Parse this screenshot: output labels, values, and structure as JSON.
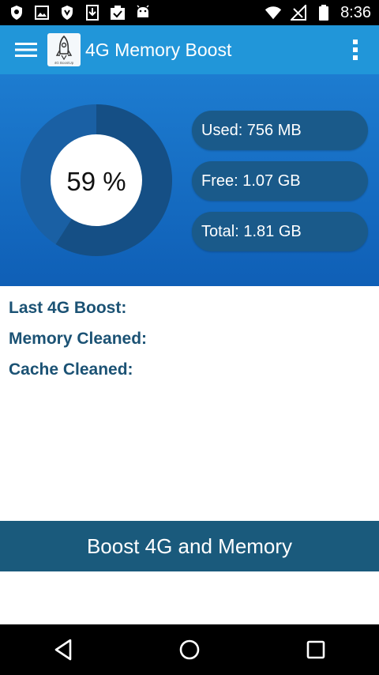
{
  "status_bar": {
    "time": "8:36",
    "left_icons": [
      "shield-icon",
      "image-icon",
      "shield-icon",
      "download-icon",
      "clipboard-check-icon",
      "android-icon"
    ],
    "right_icons": [
      "wifi-icon",
      "signal-icon",
      "battery-icon"
    ]
  },
  "app_bar": {
    "title": "4G Memory Boost",
    "logo_text": "4G BoostUp",
    "background": "#2196d9"
  },
  "memory": {
    "percent_label": "59 %",
    "used_fraction": 0.59,
    "used_label": "Used: 756 MB",
    "free_label": "Free: 1.07 GB",
    "total_label": "Total: 1.81 GB",
    "used_color": "#154f85",
    "free_color": "#1a60a4"
  },
  "info": {
    "last_boost_label": "Last 4G Boost:",
    "memory_cleaned_label": "Memory Cleaned:",
    "cache_cleaned_label": "Cache Cleaned:"
  },
  "boost_button": {
    "label": "Boost 4G and Memory",
    "color": "#1a5a7c"
  },
  "nav_bar": {
    "icons": [
      "back-icon",
      "home-icon",
      "recents-icon"
    ]
  }
}
